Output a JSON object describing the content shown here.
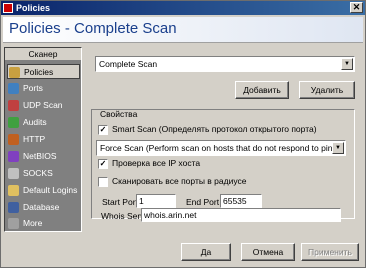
{
  "window": {
    "title": "Policies"
  },
  "header": {
    "title": "Policies - Complete Scan"
  },
  "sidebar": {
    "heading": "Сканер",
    "items": [
      {
        "label": "Policies",
        "icon": "policies-icon",
        "color": "#c8a040"
      },
      {
        "label": "Ports",
        "icon": "ports-icon",
        "color": "#4080c0"
      },
      {
        "label": "UDP Scan",
        "icon": "udp-scan-icon",
        "color": "#c04040"
      },
      {
        "label": "Audits",
        "icon": "audits-icon",
        "color": "#40a040"
      },
      {
        "label": "HTTP",
        "icon": "http-icon",
        "color": "#c06020"
      },
      {
        "label": "NetBIOS",
        "icon": "netbios-icon",
        "color": "#8040c0"
      },
      {
        "label": "SOCKS",
        "icon": "socks-icon",
        "color": "#c0c0c0"
      },
      {
        "label": "Default Logins",
        "icon": "default-logins-icon",
        "color": "#e0c060"
      },
      {
        "label": "Database",
        "icon": "database-icon",
        "color": "#4060a0"
      },
      {
        "label": "More",
        "icon": "more-icon",
        "color": "#a0a0a0"
      }
    ]
  },
  "policy_select": {
    "value": "Complete Scan"
  },
  "buttons": {
    "add": "Добавить",
    "delete": "Удалить",
    "ok": "Да",
    "cancel": "Отмена",
    "apply": "Применить"
  },
  "properties": {
    "title": "Свойства",
    "smart_scan": {
      "label": "Smart Scan (Определять протокол открытого порта)",
      "checked": true
    },
    "force_scan": {
      "value": "Force Scan (Perform scan on hosts that do not respond to pings)"
    },
    "check_all_ips": {
      "label": "Проверка все IP хоста",
      "checked": true
    },
    "scan_all_ports": {
      "label": "Сканировать все порты в радиусе",
      "checked": false
    },
    "start_port": {
      "label": "Start Port",
      "value": "1"
    },
    "end_port": {
      "label": "End Port",
      "value": "65535"
    },
    "whois_server": {
      "label": "Whois Server",
      "value": "whois.arin.net"
    }
  }
}
